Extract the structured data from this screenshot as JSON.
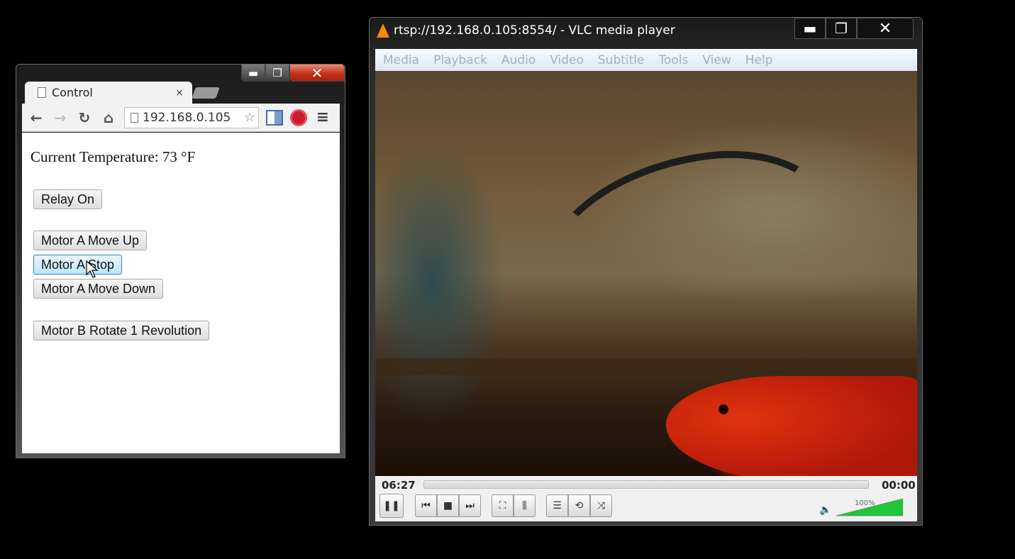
{
  "browser": {
    "tab_title": "Control",
    "tab_close": "×",
    "url": "192.168.0.105",
    "nav": {
      "back": "←",
      "forward": "→",
      "reload": "↻",
      "home": "⌂",
      "star": "☆",
      "menu": "≡"
    },
    "caption": {
      "minimize": "▬",
      "maximize": "❐",
      "close": "✕"
    },
    "page": {
      "temperature": "Current Temperature: 73 °F",
      "buttons": {
        "relay_on": "Relay On",
        "motor_a_up": "Motor A Move Up",
        "motor_a_stop": "Motor A Stop",
        "motor_a_down": "Motor A Move Down",
        "motor_b_rotate": "Motor B Rotate 1 Revolution"
      }
    }
  },
  "vlc": {
    "title": "rtsp://192.168.0.105:8554/ - VLC media player",
    "caption": {
      "minimize": "▬",
      "maximize": "❐",
      "close": "✕"
    },
    "menu": [
      "Media",
      "Playback",
      "Audio",
      "Video",
      "Subtitle",
      "Tools",
      "View",
      "Help"
    ],
    "elapsed": "06:27",
    "remaining": "00:00",
    "volume_label": "100%",
    "volume_level": 1.0,
    "accent_color": "#21c43a",
    "icons": {
      "pause": "❚❚",
      "prev": "⏮",
      "stop": "■",
      "next": "⏭",
      "fullscreen": "⛶",
      "extended": "⫼",
      "playlist": "☰",
      "loop": "⟲",
      "random": "⤨",
      "speaker": "🔈"
    }
  }
}
